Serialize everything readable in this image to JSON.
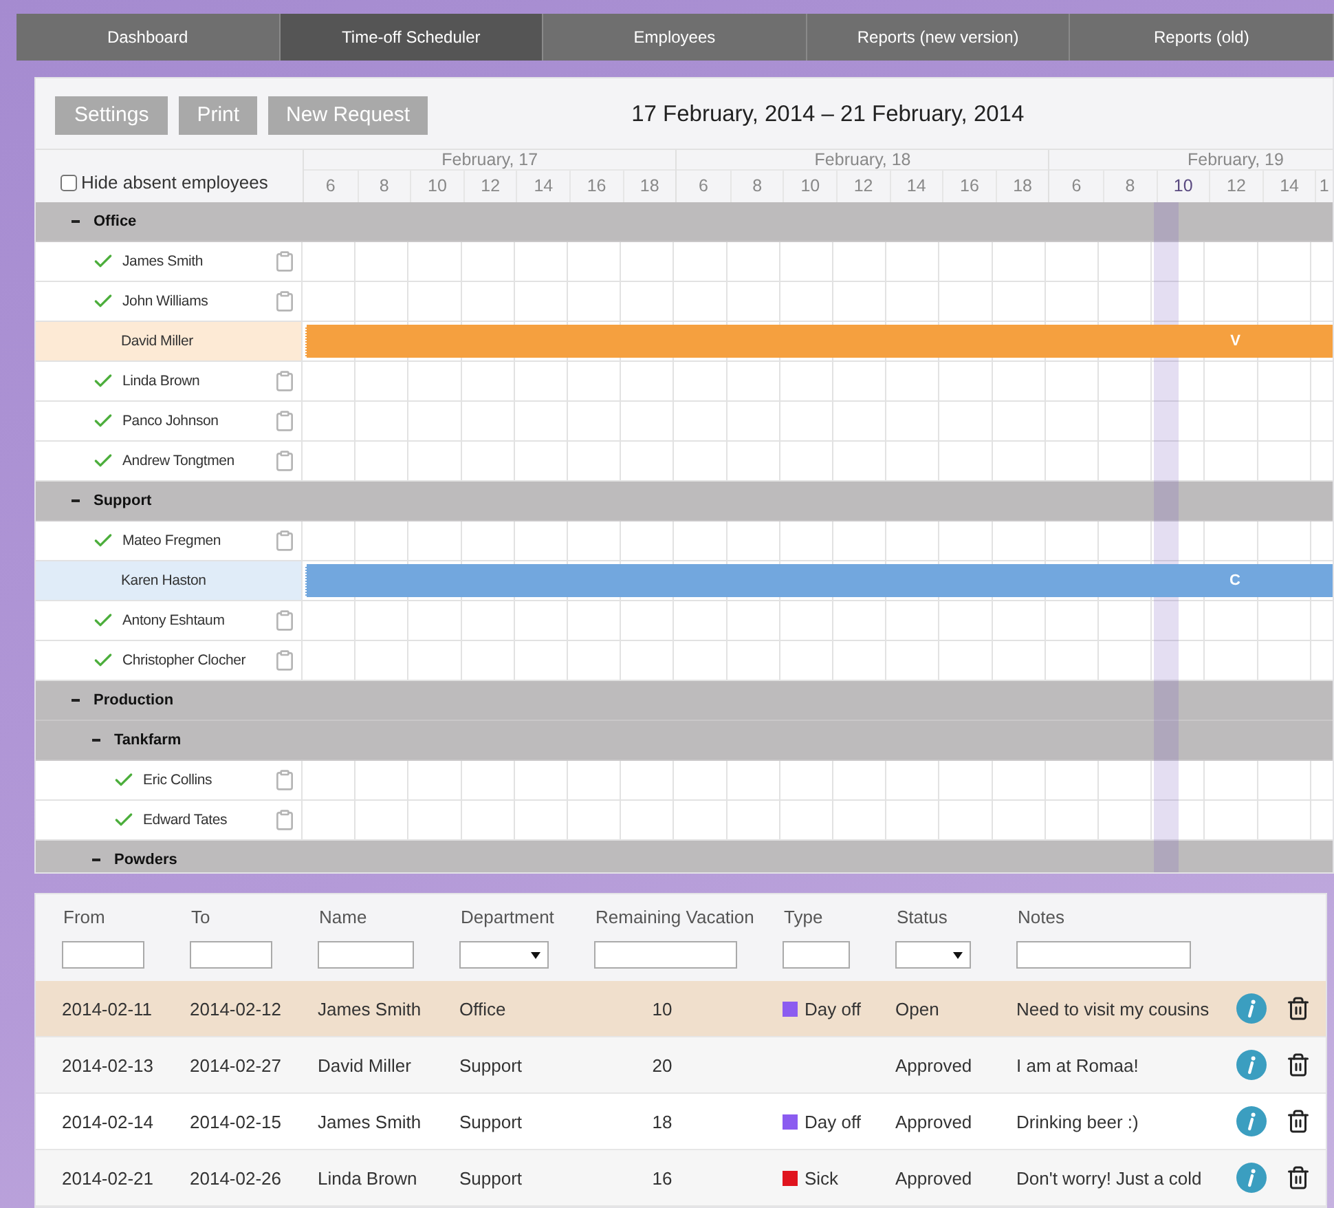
{
  "nav": {
    "tabs": [
      {
        "label": "Dashboard",
        "selected": false
      },
      {
        "label": "Time-off Scheduler",
        "selected": true
      },
      {
        "label": "Employees",
        "selected": false
      },
      {
        "label": "Reports (new version)",
        "selected": false
      },
      {
        "label": "Reports (old)",
        "selected": false
      }
    ]
  },
  "toolbar": {
    "buttons": [
      "Settings",
      "Print",
      "New Request"
    ],
    "range": "17 February, 2014 – 21 February, 2014"
  },
  "scheduler": {
    "hide_absent": {
      "label": "Hide absent employees",
      "checked": false
    },
    "days": [
      {
        "label": "February, 17",
        "hours": [
          {
            "label": "6",
            "current": false
          },
          {
            "label": "8",
            "current": false
          },
          {
            "label": "10",
            "current": false
          },
          {
            "label": "12",
            "current": false
          },
          {
            "label": "14",
            "current": false
          },
          {
            "label": "16",
            "current": false
          },
          {
            "label": "18",
            "current": false
          }
        ]
      },
      {
        "label": "February, 18",
        "hours": [
          {
            "label": "6",
            "current": false
          },
          {
            "label": "8",
            "current": false
          },
          {
            "label": "10",
            "current": false
          },
          {
            "label": "12",
            "current": false
          },
          {
            "label": "14",
            "current": false
          },
          {
            "label": "16",
            "current": false
          },
          {
            "label": "18",
            "current": false
          }
        ]
      },
      {
        "label": "February, 19",
        "hours": [
          {
            "label": "6",
            "current": false
          },
          {
            "label": "8",
            "current": false
          },
          {
            "label": "10",
            "current": true
          },
          {
            "label": "12",
            "current": false
          },
          {
            "label": "14",
            "current": false
          },
          {
            "label": "1",
            "current": false
          }
        ]
      }
    ],
    "rows": [
      {
        "kind": "group",
        "name": "Office",
        "expanded": true,
        "children": [
          {
            "kind": "employee",
            "name": "James Smith"
          },
          {
            "kind": "employee",
            "name": "John Williams"
          },
          {
            "kind": "employee",
            "name": "David Miller",
            "absence": {
              "label": "V",
              "color": "#f5a03f"
            }
          },
          {
            "kind": "employee",
            "name": "Linda Brown"
          },
          {
            "kind": "employee",
            "name": "Panco Johnson"
          },
          {
            "kind": "employee",
            "name": "Andrew Tongtmen"
          }
        ]
      },
      {
        "kind": "group",
        "name": "Support",
        "expanded": true,
        "children": [
          {
            "kind": "employee",
            "name": "Mateo Fregmen"
          },
          {
            "kind": "employee",
            "name": "Karen Haston",
            "absence": {
              "label": "C",
              "color": "#72a7de"
            }
          },
          {
            "kind": "employee",
            "name": "Antony Eshtaum"
          },
          {
            "kind": "employee",
            "name": "Christopher Clocher"
          }
        ]
      },
      {
        "kind": "group",
        "name": "Production",
        "expanded": true,
        "children": [
          {
            "kind": "group",
            "name": "Tankfarm",
            "expanded": true,
            "children": [
              {
                "kind": "employee",
                "name": "Eric Collins"
              },
              {
                "kind": "employee",
                "name": "Edward Tates"
              }
            ]
          },
          {
            "kind": "group",
            "name": "Powders",
            "expanded": true
          }
        ]
      }
    ]
  },
  "requests": {
    "columns": [
      {
        "label": "From",
        "dropdown": false
      },
      {
        "label": "To",
        "dropdown": false
      },
      {
        "label": "Name",
        "dropdown": false
      },
      {
        "label": "Department",
        "dropdown": true
      },
      {
        "label": "Remaining Vacation",
        "dropdown": false
      },
      {
        "label": "Type",
        "dropdown": false
      },
      {
        "label": "Status",
        "dropdown": true
      },
      {
        "label": "Notes",
        "dropdown": false
      }
    ],
    "rows": [
      {
        "from": "2014-02-11",
        "to": "2014-02-12",
        "name": "James Smith",
        "department": "Office",
        "remaining": "10",
        "type": {
          "label": "Day off",
          "color": "#8b5cf0"
        },
        "status": "Open",
        "notes": "Need to visit my cousins",
        "selected": true
      },
      {
        "from": "2014-02-13",
        "to": "2014-02-27",
        "name": "David Miller",
        "department": "Support",
        "remaining": "20",
        "status": "Approved",
        "notes": "I am at Romaa!",
        "selected": false
      },
      {
        "from": "2014-02-14",
        "to": "2014-02-15",
        "name": "James Smith",
        "department": "Support",
        "remaining": "18",
        "type": {
          "label": "Day off",
          "color": "#8b5cf0"
        },
        "status": "Approved",
        "notes": "Drinking beer :)",
        "selected": false
      },
      {
        "from": "2014-02-21",
        "to": "2014-02-26",
        "name": "Linda Brown",
        "department": "Support",
        "remaining": "16",
        "type": {
          "label": "Sick",
          "color": "#e0141e"
        },
        "status": "Approved",
        "notes": "Don't worry! Just a cold",
        "selected": false
      }
    ]
  }
}
